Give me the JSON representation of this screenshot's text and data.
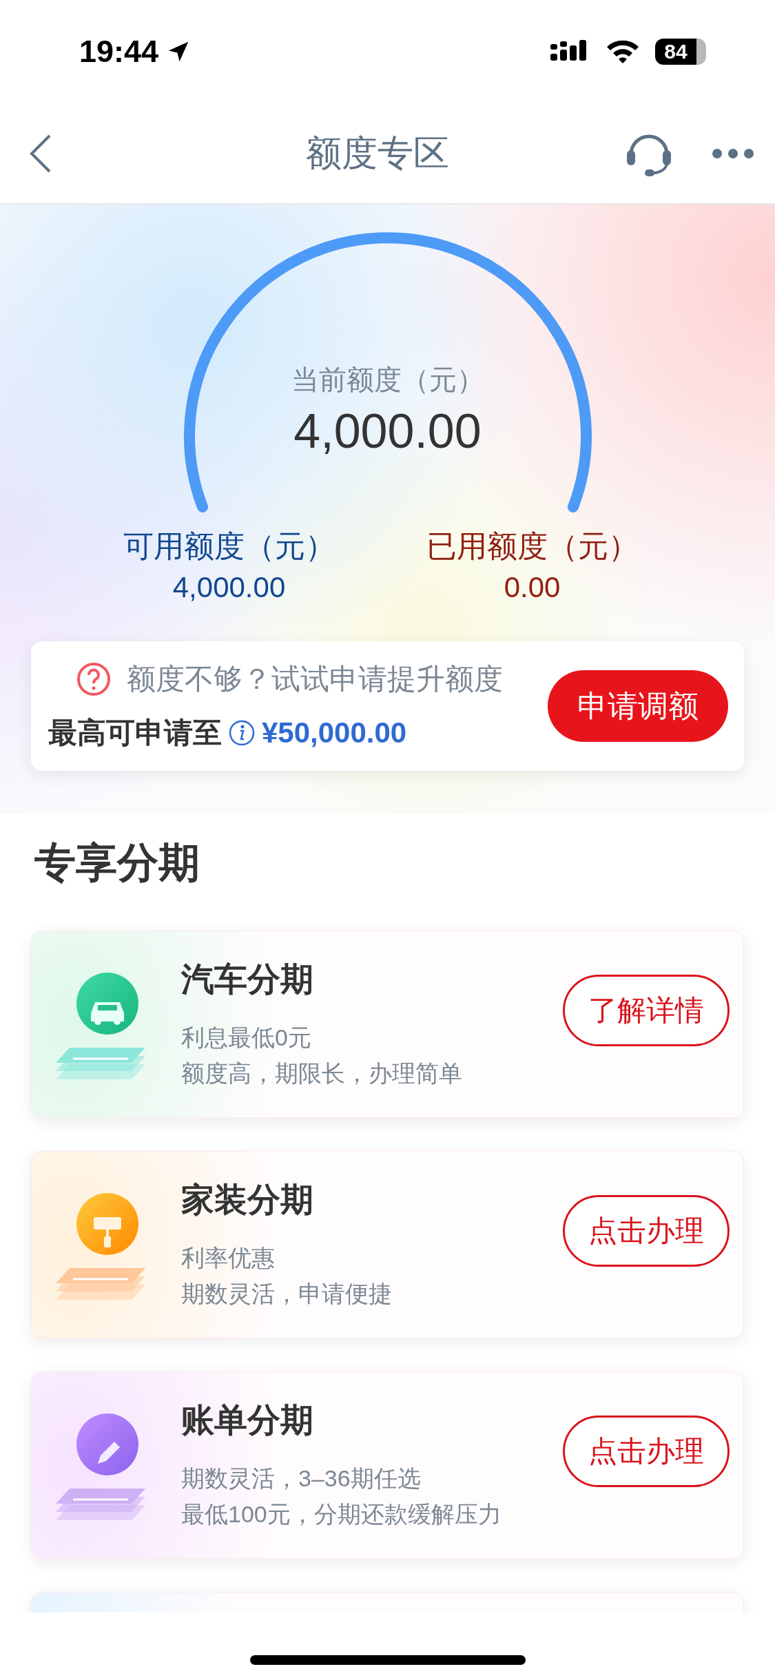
{
  "status_bar": {
    "time": "19:44",
    "battery": "84"
  },
  "nav": {
    "title": "额度专区"
  },
  "quota": {
    "label": "当前额度（元）",
    "amount": "4,000.00",
    "available": {
      "label": "可用额度（元）",
      "value": "4,000.00"
    },
    "used": {
      "label": "已用额度（元）",
      "value": "0.00"
    }
  },
  "raise": {
    "hint": "额度不够？试试申请提升额度",
    "max_label": "最高可申请至",
    "max_value": "¥50,000.00",
    "button": "申请调额"
  },
  "section_title": "专享分期",
  "products": [
    {
      "kind": "car",
      "title": "汽车分期",
      "lines": [
        "利息最低0元",
        "额度高，期限长，办理简单"
      ],
      "button": "了解详情"
    },
    {
      "kind": "home",
      "title": "家装分期",
      "lines": [
        "利率优惠",
        "期数灵活，申请便捷"
      ],
      "button": "点击办理"
    },
    {
      "kind": "bill",
      "title": "账单分期",
      "lines": [
        "期数灵活，3–36期任选",
        "最低100元，分期还款缓解压力"
      ],
      "button": "点击办理"
    }
  ]
}
